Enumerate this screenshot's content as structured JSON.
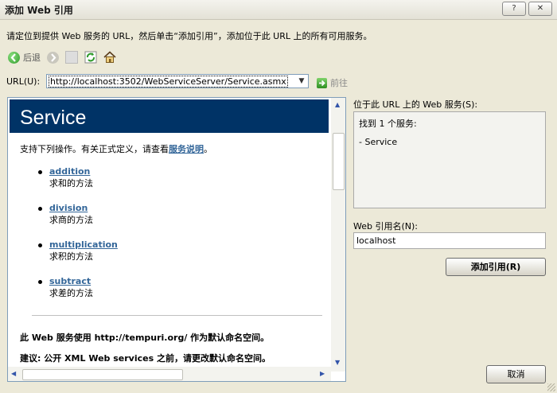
{
  "window": {
    "title": "添加 Web 引用",
    "help_label": "?",
    "close_label": "✕"
  },
  "instruction": "请定位到提供 Web 服务的 URL，然后单击“添加引用”，添加位于此 URL 上的所有可用服务。",
  "toolbar": {
    "back_label": "后退"
  },
  "url": {
    "label": "URL(U):",
    "value": "http://localhost:3502/WebServiceServer/Service.asmx",
    "go_label": "前往"
  },
  "service_page": {
    "title": "Service",
    "intro_text": "支持下列操作。有关正式定义，请查看",
    "intro_link": "服务说明",
    "intro_end": "。",
    "operations": [
      {
        "name": "addition",
        "desc": "求和的方法"
      },
      {
        "name": "division",
        "desc": "求商的方法"
      },
      {
        "name": "multiplication",
        "desc": "求积的方法"
      },
      {
        "name": "subtract",
        "desc": "求差的方法"
      }
    ],
    "namespace_note": "此 Web 服务使用 http://tempuri.org/ 作为默认命名空间。",
    "advice_note": "建议: 公开 XML Web services 之前，请更改默认命名空间。"
  },
  "services_found": {
    "label": "位于此 URL 上的 Web 服务(S):",
    "summary": "找到 1 个服务:",
    "items": [
      "- Service"
    ]
  },
  "reference_name": {
    "label": "Web 引用名(N):",
    "value": "localhost"
  },
  "buttons": {
    "add_reference": "添加引用(R)",
    "cancel": "取消"
  },
  "colors": {
    "service_header_bg": "#003366",
    "link": "#336699"
  }
}
